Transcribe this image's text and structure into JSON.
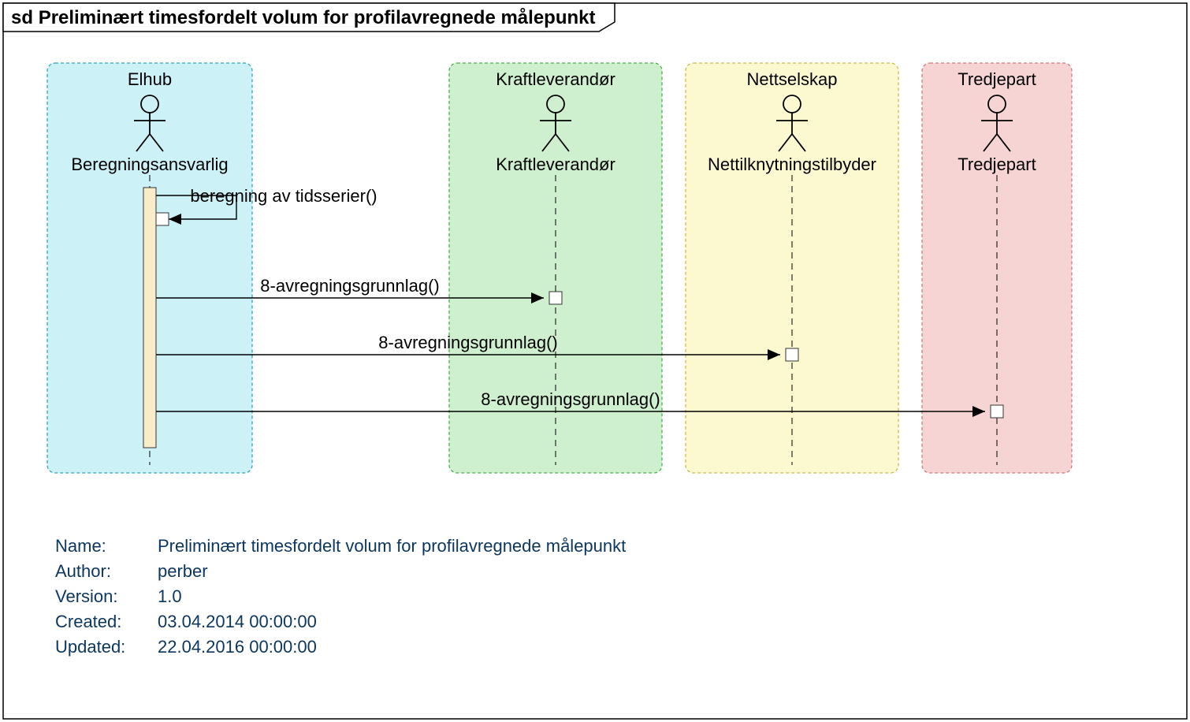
{
  "frame": {
    "prefix": "sd",
    "title": "Preliminært timesfordelt volum for profilavregnede målepunkt"
  },
  "lanes": [
    {
      "header": "Elhub",
      "actor": "Beregningsansvarlig",
      "fill": "#CCF2F8",
      "stroke": "#2BA7B8"
    },
    {
      "header": "Kraftleverandør",
      "actor": "Kraftleverandør",
      "fill": "#CEF0CE",
      "stroke": "#4CAF50"
    },
    {
      "header": "Nettselskap",
      "actor": "Nettilknytningstilbyder",
      "fill": "#FCF9D0",
      "stroke": "#C9BE4A"
    },
    {
      "header": "Tredjepart",
      "actor": "Tredjepart",
      "fill": "#F6D4D4",
      "stroke": "#D17B7B"
    }
  ],
  "messages": {
    "self": "beregning av tidsserier()",
    "m1": "8-avregningsgrunnlag()",
    "m2": "8-avregningsgrunnlag()",
    "m3": "8-avregningsgrunnlag()"
  },
  "meta": {
    "name_label": "Name:",
    "name_value": "Preliminært timesfordelt volum for profilavregnede målepunkt",
    "author_label": "Author:",
    "author_value": "perber",
    "version_label": "Version:",
    "version_value": "1.0",
    "created_label": "Created:",
    "created_value": "03.04.2014 00:00:00",
    "updated_label": "Updated:",
    "updated_value": "22.04.2016 00:00:00"
  }
}
